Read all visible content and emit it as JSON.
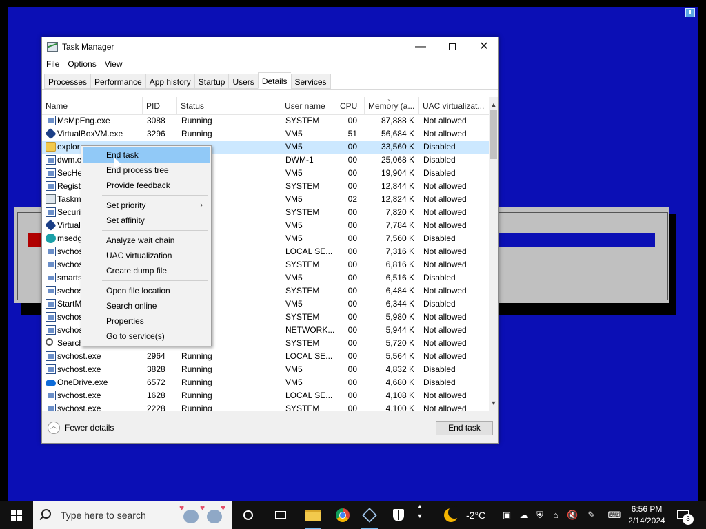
{
  "window": {
    "title": "Task Manager",
    "minimize": "—",
    "close": "✕"
  },
  "menu": [
    "File",
    "Options",
    "View"
  ],
  "tabs": [
    "Processes",
    "Performance",
    "App history",
    "Startup",
    "Users",
    "Details",
    "Services"
  ],
  "active_tab": "Details",
  "columns": {
    "name": "Name",
    "pid": "PID",
    "status": "Status",
    "user": "User name",
    "cpu": "CPU",
    "memory": "Memory (a...",
    "uac": "UAC virtualizat..."
  },
  "rows": [
    {
      "icon": "win",
      "name": "MsMpEng.exe",
      "pid": "3088",
      "status": "Running",
      "user": "SYSTEM",
      "cpu": "00",
      "mem": "87,888 K",
      "uac": "Not allowed"
    },
    {
      "icon": "vbox",
      "name": "VirtualBoxVM.exe",
      "pid": "3296",
      "status": "Running",
      "user": "VM5",
      "cpu": "51",
      "mem": "56,684 K",
      "uac": "Not allowed"
    },
    {
      "icon": "folder",
      "name": "explor",
      "pid": "",
      "status": "",
      "user": "VM5",
      "cpu": "00",
      "mem": "33,560 K",
      "uac": "Disabled",
      "selected": true
    },
    {
      "icon": "win",
      "name": "dwm.e",
      "pid": "",
      "status": "",
      "user": "DWM-1",
      "cpu": "00",
      "mem": "25,068 K",
      "uac": "Disabled"
    },
    {
      "icon": "win",
      "name": "SecHe",
      "pid": "",
      "status": "",
      "user": "VM5",
      "cpu": "00",
      "mem": "19,904 K",
      "uac": "Disabled"
    },
    {
      "icon": "win",
      "name": "Registr",
      "pid": "",
      "status": "",
      "user": "SYSTEM",
      "cpu": "00",
      "mem": "12,844 K",
      "uac": "Not allowed"
    },
    {
      "icon": "tm",
      "name": "Taskm",
      "pid": "",
      "status": "",
      "user": "VM5",
      "cpu": "02",
      "mem": "12,824 K",
      "uac": "Not allowed"
    },
    {
      "icon": "win",
      "name": "Securit",
      "pid": "",
      "status": "",
      "user": "SYSTEM",
      "cpu": "00",
      "mem": "7,820 K",
      "uac": "Not allowed"
    },
    {
      "icon": "vbox",
      "name": "Virtual",
      "pid": "",
      "status": "",
      "user": "VM5",
      "cpu": "00",
      "mem": "7,784 K",
      "uac": "Not allowed"
    },
    {
      "icon": "edge",
      "name": "msedg",
      "pid": "",
      "status": "",
      "user": "VM5",
      "cpu": "00",
      "mem": "7,560 K",
      "uac": "Disabled"
    },
    {
      "icon": "win",
      "name": "svchos",
      "pid": "",
      "status": "",
      "user": "LOCAL SE...",
      "cpu": "00",
      "mem": "7,316 K",
      "uac": "Not allowed"
    },
    {
      "icon": "win",
      "name": "svchos",
      "pid": "",
      "status": "",
      "user": "SYSTEM",
      "cpu": "00",
      "mem": "6,816 K",
      "uac": "Not allowed"
    },
    {
      "icon": "win",
      "name": "smarts",
      "pid": "",
      "status": "",
      "user": "VM5",
      "cpu": "00",
      "mem": "6,516 K",
      "uac": "Disabled"
    },
    {
      "icon": "win",
      "name": "svchos",
      "pid": "",
      "status": "",
      "user": "SYSTEM",
      "cpu": "00",
      "mem": "6,484 K",
      "uac": "Not allowed"
    },
    {
      "icon": "win",
      "name": "StartM",
      "pid": "",
      "status": "",
      "user": "VM5",
      "cpu": "00",
      "mem": "6,344 K",
      "uac": "Disabled"
    },
    {
      "icon": "win",
      "name": "svchos",
      "pid": "",
      "status": "",
      "user": "SYSTEM",
      "cpu": "00",
      "mem": "5,980 K",
      "uac": "Not allowed"
    },
    {
      "icon": "win",
      "name": "svchos",
      "pid": "",
      "status": "",
      "user": "NETWORK...",
      "cpu": "00",
      "mem": "5,944 K",
      "uac": "Not allowed"
    },
    {
      "icon": "search",
      "name": "Search",
      "pid": "",
      "status": "",
      "user": "SYSTEM",
      "cpu": "00",
      "mem": "5,720 K",
      "uac": "Not allowed"
    },
    {
      "icon": "win",
      "name": "svchost.exe",
      "pid": "2964",
      "status": "Running",
      "user": "LOCAL SE...",
      "cpu": "00",
      "mem": "5,564 K",
      "uac": "Not allowed"
    },
    {
      "icon": "win",
      "name": "svchost.exe",
      "pid": "3828",
      "status": "Running",
      "user": "VM5",
      "cpu": "00",
      "mem": "4,832 K",
      "uac": "Disabled"
    },
    {
      "icon": "cloud",
      "name": "OneDrive.exe",
      "pid": "6572",
      "status": "Running",
      "user": "VM5",
      "cpu": "00",
      "mem": "4,680 K",
      "uac": "Disabled"
    },
    {
      "icon": "win",
      "name": "svchost.exe",
      "pid": "1628",
      "status": "Running",
      "user": "LOCAL SE...",
      "cpu": "00",
      "mem": "4,108 K",
      "uac": "Not allowed"
    },
    {
      "icon": "win",
      "name": "svchost.exe",
      "pid": "2228",
      "status": "Running",
      "user": "SYSTEM",
      "cpu": "00",
      "mem": "4,100 K",
      "uac": "Not allowed"
    }
  ],
  "context_menu": {
    "groups": [
      [
        "End task",
        "End process tree",
        "Provide feedback"
      ],
      [
        "Set priority",
        "Set affinity"
      ],
      [
        "Analyze wait chain",
        "UAC virtualization",
        "Create dump file"
      ],
      [
        "Open file location",
        "Search online",
        "Properties",
        "Go to service(s)"
      ]
    ],
    "highlighted": "End task",
    "submenu_item": "Set priority"
  },
  "footer": {
    "fewer_details": "Fewer details",
    "end_task": "End task"
  },
  "taskbar": {
    "search_placeholder": "Type here to search",
    "weather": "-2°C",
    "time": "6:56 PM",
    "date": "2/14/2024",
    "notification_count": "3"
  }
}
